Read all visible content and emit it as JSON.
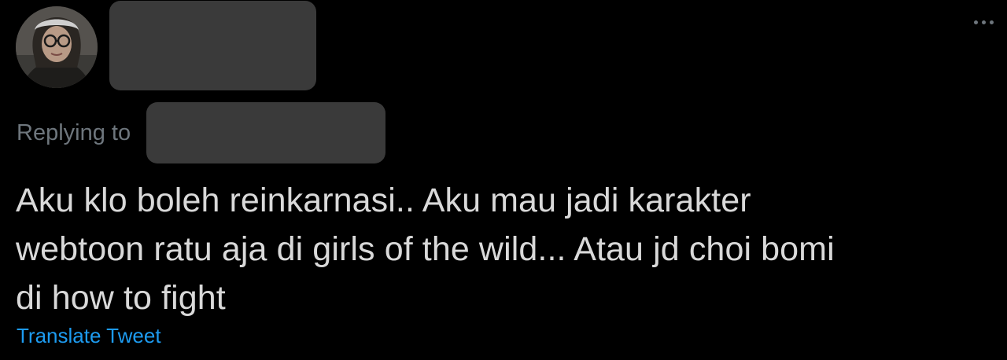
{
  "tweet": {
    "avatar_icon": "user-avatar-photo",
    "more_icon": "more-options-icon",
    "replying_label": "Replying to",
    "text_lines": [
      "Aku klo boleh reinkarnasi.. Aku mau jadi karakter",
      "webtoon ratu aja di girls of the wild... Atau jd choi bomi",
      "di how to fight"
    ],
    "translate_label": "Translate Tweet"
  },
  "colors": {
    "background": "#000000",
    "text": "#d9d9d9",
    "muted": "#6e767d",
    "link": "#1d9bf0",
    "redaction": "#3a3a3a"
  }
}
